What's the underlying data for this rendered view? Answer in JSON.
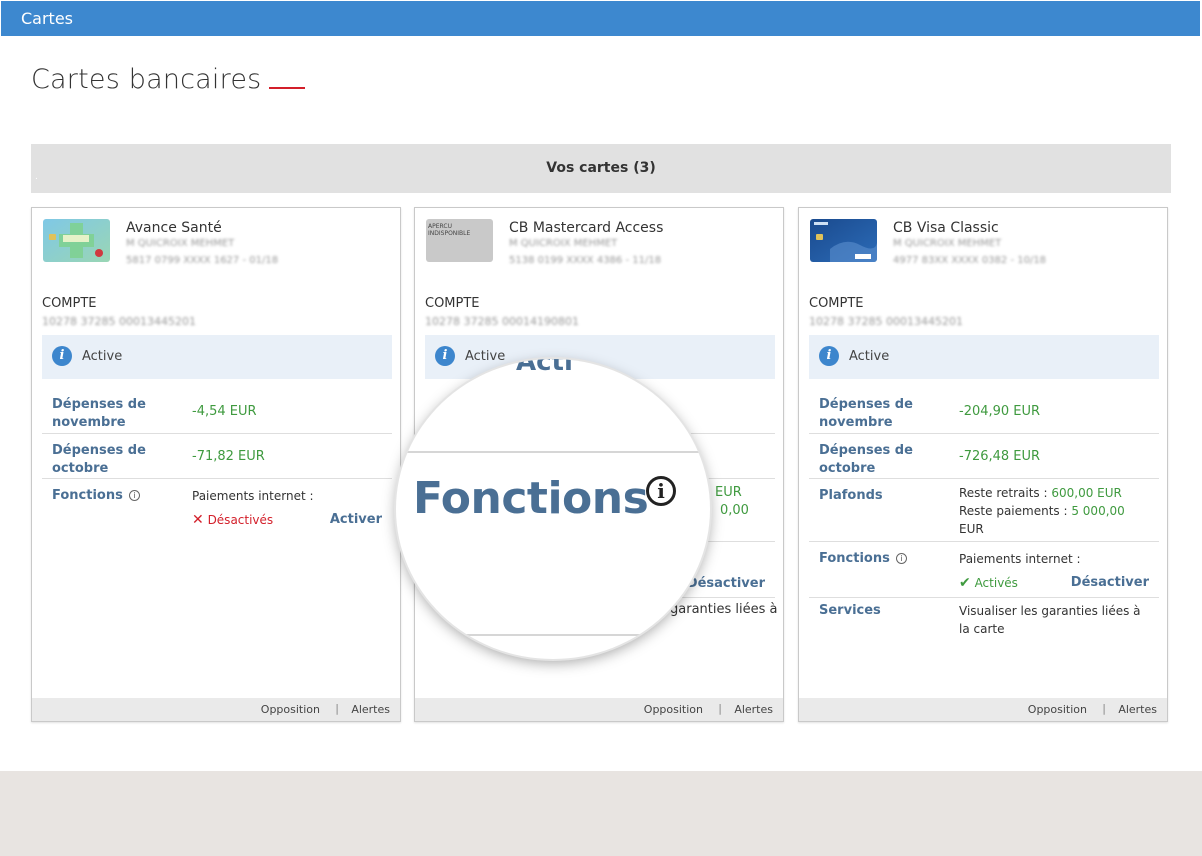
{
  "app": {
    "title": "Cartes"
  },
  "page": {
    "title": "Cartes bancaires"
  },
  "section": {
    "title": "Vos cartes (3)",
    "dot": "."
  },
  "cards": [
    {
      "name": "Avance Santé",
      "holder": "M QUICROIX MEHMET",
      "number": "5817 0799 XXXX 1627 - 01/18",
      "thumb": "health-card",
      "compte_label": "COMPTE",
      "compte_num": "10278 37285 00013445201",
      "status": "Active",
      "depenses_nov_label": "Dépenses de novembre",
      "depenses_nov": "-4,54 EUR",
      "depenses_oct_label": "Dépenses de octobre",
      "depenses_oct": "-71,82 EUR",
      "fonctions_label": "Fonctions",
      "paiements_label": "Paiements internet :",
      "state": "Désactivés",
      "action": "Activer",
      "footer": {
        "opposition": "Opposition",
        "alertes": "Alertes"
      }
    },
    {
      "name": "CB Mastercard Access",
      "holder": "M QUICROIX MEHMET",
      "number": "5138 0199 XXXX 4386 - 11/18",
      "thumb": "apercu-indisponible",
      "thumb_text": "APERCU INDISPONIBLE",
      "compte_label": "COMPTE",
      "compte_num": "10278 37285 00014190801",
      "status": "Active",
      "partial_eur": "EUR",
      "partial_amount": "0,00",
      "action": "Désactiver",
      "services_partial": "garanties liées à",
      "footer": {
        "opposition": "Opposition",
        "alertes": "Alertes"
      }
    },
    {
      "name": "CB Visa Classic",
      "holder": "M QUICROIX MEHMET",
      "number": "4977 83XX XXXX 0382 - 10/18",
      "thumb": "visa-card",
      "compte_label": "COMPTE",
      "compte_num": "10278 37285 00013445201",
      "status": "Active",
      "depenses_nov_label": "Dépenses de novembre",
      "depenses_nov": "-204,90 EUR",
      "depenses_oct_label": "Dépenses de octobre",
      "depenses_oct": "-726,48 EUR",
      "plafonds_label": "Plafonds",
      "reste_retraits_label": "Reste retraits :",
      "reste_retraits": "600,00 EUR",
      "reste_paiements_label": "Reste paiements :",
      "reste_paiements": "5 000,00",
      "reste_paiements_unit": "EUR",
      "fonctions_label": "Fonctions",
      "paiements_label": "Paiements internet :",
      "state": "Activés",
      "action": "Désactiver",
      "services_label": "Services",
      "services_text": "Visualiser les garanties liées à la carte",
      "footer": {
        "opposition": "Opposition",
        "alertes": "Alertes"
      }
    }
  ],
  "magnifier": {
    "text": "Fonctions",
    "top_fragment": "Acti"
  },
  "colors": {
    "topbar": "#3d88cf",
    "accent_red": "#d31f2a",
    "label_blue": "#4a6f94",
    "value_green": "#3f9a3f",
    "status_bg": "#e9f0f8"
  },
  "icons": [
    "info-icon",
    "small-info-icon",
    "cross-icon",
    "check-icon"
  ]
}
